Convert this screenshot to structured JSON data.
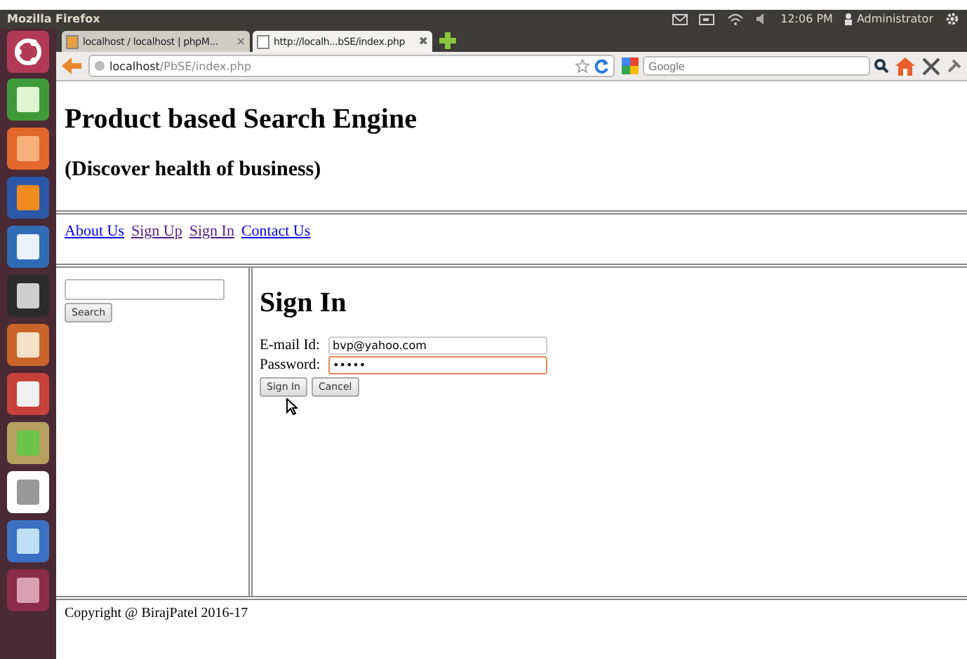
{
  "top_panel": {
    "app_name": "Mozilla Firefox",
    "clock": "12:06 PM",
    "user": "Administrator"
  },
  "tabs": [
    {
      "title": "localhost / localhost | phpM...",
      "selected": false,
      "close": "×"
    },
    {
      "title": "http://localh...bSE/index.php",
      "selected": true,
      "close": "✖"
    }
  ],
  "address_bar": {
    "host": "localhost",
    "path": "/PbSE/index.php"
  },
  "search_bar": {
    "placeholder": "Google"
  },
  "page": {
    "title": "Product based Search Engine",
    "subtitle": "(Discover health of business)",
    "nav_links": [
      {
        "label": "About Us",
        "visited": false
      },
      {
        "label": "Sign Up",
        "visited": true
      },
      {
        "label": "Sign In",
        "visited": true
      },
      {
        "label": "Contact Us",
        "visited": false
      }
    ],
    "sidebar": {
      "search_button": "Search"
    },
    "form": {
      "heading": "Sign In",
      "fields": [
        {
          "label": "E-mail Id:",
          "value": "bvp@yahoo.com",
          "focused": false
        },
        {
          "label": "Password:",
          "value": "•••••",
          "focused": true
        }
      ],
      "buttons": [
        "Sign In",
        "Cancel"
      ]
    },
    "footer": "Copyright @ BirajPatel 2016-17"
  }
}
